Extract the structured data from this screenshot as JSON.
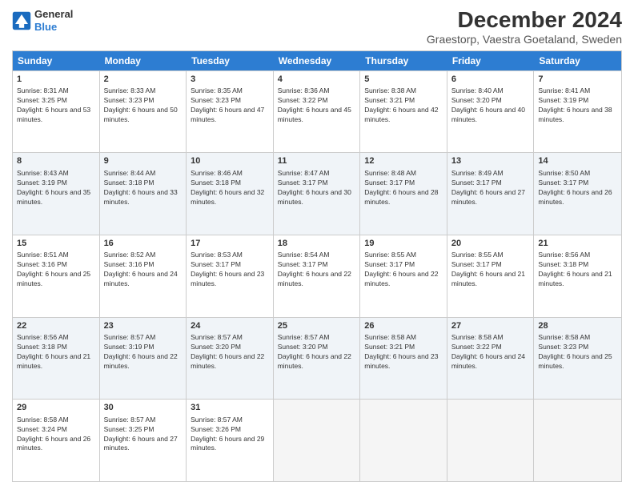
{
  "logo": {
    "line1": "General",
    "line2": "Blue"
  },
  "title": "December 2024",
  "subtitle": "Graestorp, Vaestra Goetaland, Sweden",
  "days": [
    "Sunday",
    "Monday",
    "Tuesday",
    "Wednesday",
    "Thursday",
    "Friday",
    "Saturday"
  ],
  "weeks": [
    [
      {
        "num": "1",
        "sunrise": "8:31 AM",
        "sunset": "3:25 PM",
        "daylight": "6 hours and 53 minutes."
      },
      {
        "num": "2",
        "sunrise": "8:33 AM",
        "sunset": "3:23 PM",
        "daylight": "6 hours and 50 minutes."
      },
      {
        "num": "3",
        "sunrise": "8:35 AM",
        "sunset": "3:23 PM",
        "daylight": "6 hours and 47 minutes."
      },
      {
        "num": "4",
        "sunrise": "8:36 AM",
        "sunset": "3:22 PM",
        "daylight": "6 hours and 45 minutes."
      },
      {
        "num": "5",
        "sunrise": "8:38 AM",
        "sunset": "3:21 PM",
        "daylight": "6 hours and 42 minutes."
      },
      {
        "num": "6",
        "sunrise": "8:40 AM",
        "sunset": "3:20 PM",
        "daylight": "6 hours and 40 minutes."
      },
      {
        "num": "7",
        "sunrise": "8:41 AM",
        "sunset": "3:19 PM",
        "daylight": "6 hours and 38 minutes."
      }
    ],
    [
      {
        "num": "8",
        "sunrise": "8:43 AM",
        "sunset": "3:19 PM",
        "daylight": "6 hours and 35 minutes."
      },
      {
        "num": "9",
        "sunrise": "8:44 AM",
        "sunset": "3:18 PM",
        "daylight": "6 hours and 33 minutes."
      },
      {
        "num": "10",
        "sunrise": "8:46 AM",
        "sunset": "3:18 PM",
        "daylight": "6 hours and 32 minutes."
      },
      {
        "num": "11",
        "sunrise": "8:47 AM",
        "sunset": "3:17 PM",
        "daylight": "6 hours and 30 minutes."
      },
      {
        "num": "12",
        "sunrise": "8:48 AM",
        "sunset": "3:17 PM",
        "daylight": "6 hours and 28 minutes."
      },
      {
        "num": "13",
        "sunrise": "8:49 AM",
        "sunset": "3:17 PM",
        "daylight": "6 hours and 27 minutes."
      },
      {
        "num": "14",
        "sunrise": "8:50 AM",
        "sunset": "3:17 PM",
        "daylight": "6 hours and 26 minutes."
      }
    ],
    [
      {
        "num": "15",
        "sunrise": "8:51 AM",
        "sunset": "3:16 PM",
        "daylight": "6 hours and 25 minutes."
      },
      {
        "num": "16",
        "sunrise": "8:52 AM",
        "sunset": "3:16 PM",
        "daylight": "6 hours and 24 minutes."
      },
      {
        "num": "17",
        "sunrise": "8:53 AM",
        "sunset": "3:17 PM",
        "daylight": "6 hours and 23 minutes."
      },
      {
        "num": "18",
        "sunrise": "8:54 AM",
        "sunset": "3:17 PM",
        "daylight": "6 hours and 22 minutes."
      },
      {
        "num": "19",
        "sunrise": "8:55 AM",
        "sunset": "3:17 PM",
        "daylight": "6 hours and 22 minutes."
      },
      {
        "num": "20",
        "sunrise": "8:55 AM",
        "sunset": "3:17 PM",
        "daylight": "6 hours and 21 minutes."
      },
      {
        "num": "21",
        "sunrise": "8:56 AM",
        "sunset": "3:18 PM",
        "daylight": "6 hours and 21 minutes."
      }
    ],
    [
      {
        "num": "22",
        "sunrise": "8:56 AM",
        "sunset": "3:18 PM",
        "daylight": "6 hours and 21 minutes."
      },
      {
        "num": "23",
        "sunrise": "8:57 AM",
        "sunset": "3:19 PM",
        "daylight": "6 hours and 22 minutes."
      },
      {
        "num": "24",
        "sunrise": "8:57 AM",
        "sunset": "3:20 PM",
        "daylight": "6 hours and 22 minutes."
      },
      {
        "num": "25",
        "sunrise": "8:57 AM",
        "sunset": "3:20 PM",
        "daylight": "6 hours and 22 minutes."
      },
      {
        "num": "26",
        "sunrise": "8:58 AM",
        "sunset": "3:21 PM",
        "daylight": "6 hours and 23 minutes."
      },
      {
        "num": "27",
        "sunrise": "8:58 AM",
        "sunset": "3:22 PM",
        "daylight": "6 hours and 24 minutes."
      },
      {
        "num": "28",
        "sunrise": "8:58 AM",
        "sunset": "3:23 PM",
        "daylight": "6 hours and 25 minutes."
      }
    ],
    [
      {
        "num": "29",
        "sunrise": "8:58 AM",
        "sunset": "3:24 PM",
        "daylight": "6 hours and 26 minutes."
      },
      {
        "num": "30",
        "sunrise": "8:57 AM",
        "sunset": "3:25 PM",
        "daylight": "6 hours and 27 minutes."
      },
      {
        "num": "31",
        "sunrise": "8:57 AM",
        "sunset": "3:26 PM",
        "daylight": "6 hours and 29 minutes."
      },
      null,
      null,
      null,
      null
    ]
  ]
}
